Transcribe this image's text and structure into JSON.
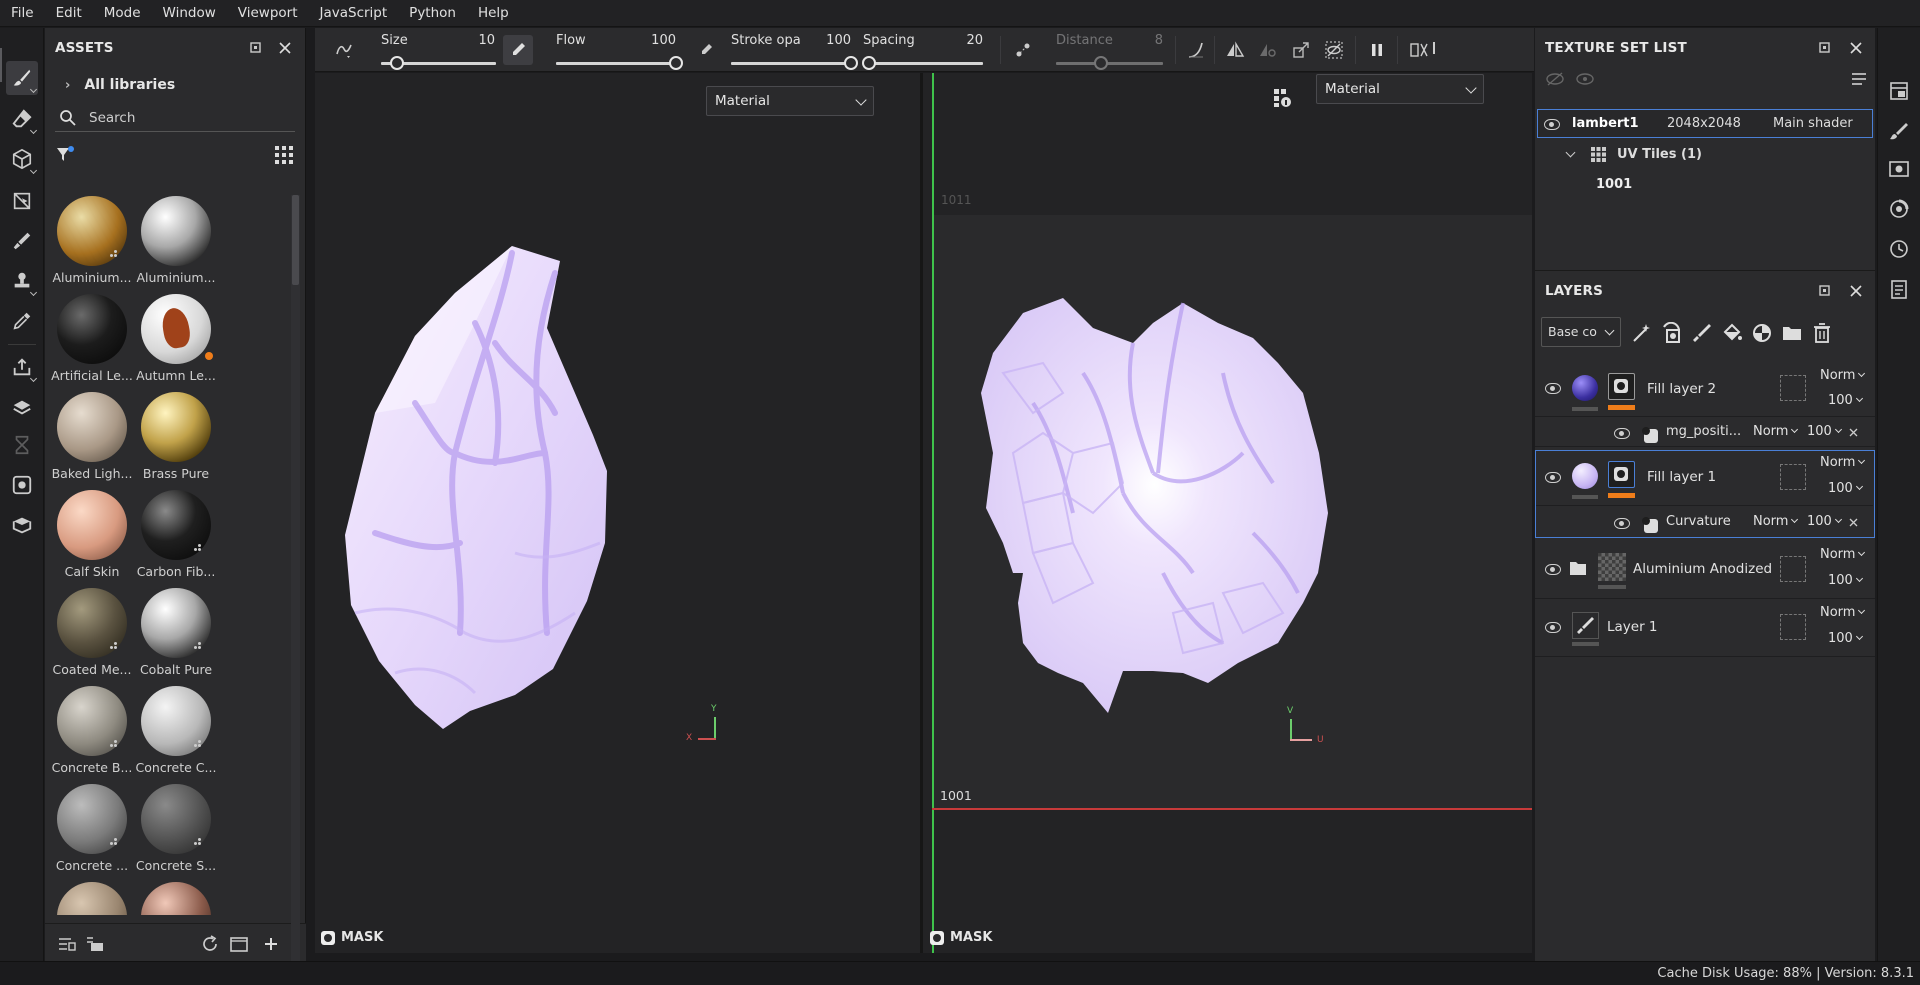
{
  "menu": [
    "File",
    "Edit",
    "Mode",
    "Window",
    "Viewport",
    "JavaScript",
    "Python",
    "Help"
  ],
  "assets": {
    "title": "ASSETS",
    "library": "All libraries",
    "search_placeholder": "Search",
    "items": [
      {
        "label": "Aluminium...",
        "style": "gold-hex"
      },
      {
        "label": "Aluminium...",
        "style": "chrome"
      },
      {
        "label": "Artificial Le...",
        "style": "black"
      },
      {
        "label": "Autumn Le...",
        "style": "leaf"
      },
      {
        "label": "Baked Ligh...",
        "style": "beige"
      },
      {
        "label": "Brass Pure",
        "style": "brass"
      },
      {
        "label": "Calf Skin",
        "style": "skin"
      },
      {
        "label": "Carbon Fib...",
        "style": "carbon"
      },
      {
        "label": "Coated Me...",
        "style": "olive"
      },
      {
        "label": "Cobalt Pure",
        "style": "chrome"
      },
      {
        "label": "Concrete B...",
        "style": "concrete-light"
      },
      {
        "label": "Concrete C...",
        "style": "concrete-white"
      },
      {
        "label": "Concrete ...",
        "style": "concrete-mid"
      },
      {
        "label": "Concrete S...",
        "style": "concrete-dark"
      },
      {
        "label": "",
        "style": "tan"
      },
      {
        "label": "",
        "style": "copper"
      }
    ]
  },
  "brush": {
    "size_label": "Size",
    "size_value": "10",
    "size_fraction": 0.14,
    "flow_label": "Flow",
    "flow_value": "100",
    "flow_fraction": 1.0,
    "stroke_label": "Stroke opac",
    "stroke_value": "100",
    "stroke_fraction": 1.0,
    "spacing_label": "Spacing",
    "spacing_value": "20",
    "spacing_fraction": 0.05,
    "distance_label": "Distance",
    "distance_value": "8",
    "distance_fraction": 0.42
  },
  "viewport3d": {
    "mode": "Material",
    "mask": "MASK"
  },
  "viewport2d": {
    "mode": "Material",
    "mask": "MASK",
    "tile_top": "1011",
    "tile_bottom": "1001",
    "axis_v": "V",
    "axis_u": "U"
  },
  "texture_set_list": {
    "title": "TEXTURE SET LIST",
    "set_name": "lambert1",
    "resolution": "2048x2048",
    "shader": "Main shader",
    "uv_tiles": "UV Tiles (1)",
    "tile": "1001"
  },
  "layers": {
    "title": "LAYERS",
    "channel": "Base co",
    "rows": [
      {
        "name": "Fill layer 2",
        "blend": "Norm",
        "opacity": "100",
        "thumb": "#4a3fb0"
      },
      {
        "name": "mg_positi...",
        "blend": "Norm",
        "opacity": "100"
      },
      {
        "name": "Fill layer 1",
        "blend": "Norm",
        "opacity": "100",
        "thumb": "#c8b8f0"
      },
      {
        "name": "Curvature",
        "blend": "Norm",
        "opacity": "100"
      },
      {
        "name": "Aluminium Anodized ...",
        "blend": "Norm",
        "opacity": "100"
      },
      {
        "name": "Layer 1",
        "blend": "Norm",
        "opacity": "100"
      }
    ]
  },
  "status": "Cache Disk Usage:   88% | Version: 8.3.1",
  "colors": {
    "accent": "#4a7fd6",
    "orange": "#ef7d1a",
    "mesh": "#e6dcfb",
    "mesh_vein": "#b79cf0"
  }
}
